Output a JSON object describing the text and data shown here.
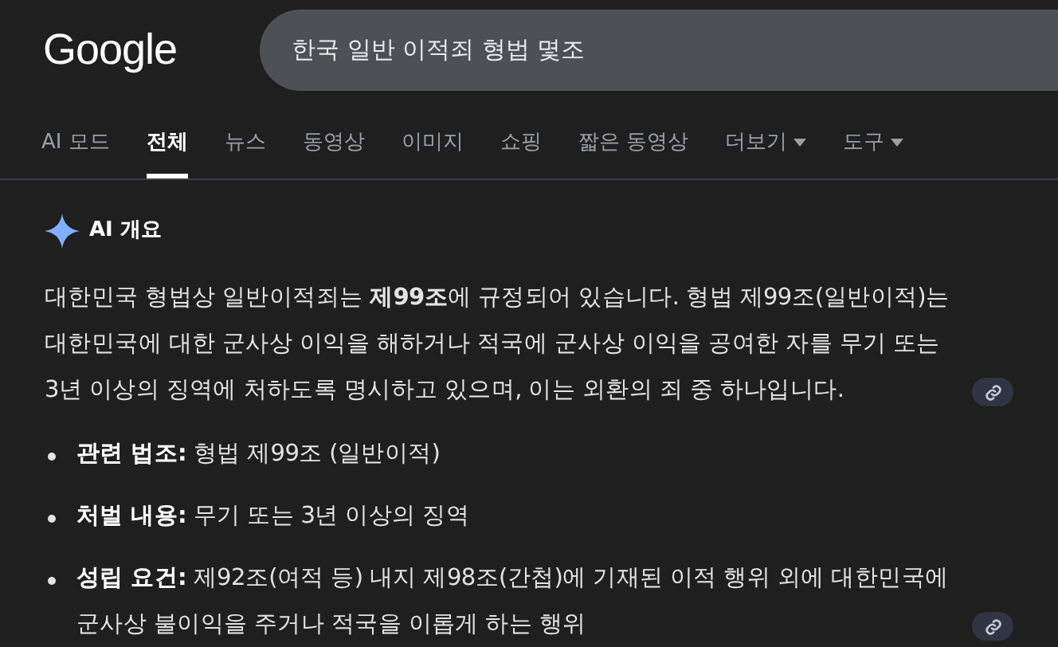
{
  "logo": "Google",
  "search": {
    "value": "한국 일반 이적죄 형법 몇조"
  },
  "tabs": [
    {
      "label": "AI 모드",
      "selected": false,
      "kind": "plain"
    },
    {
      "label": "전체",
      "selected": true,
      "kind": "plain"
    },
    {
      "label": "뉴스",
      "selected": false,
      "kind": "plain"
    },
    {
      "label": "동영상",
      "selected": false,
      "kind": "plain"
    },
    {
      "label": "이미지",
      "selected": false,
      "kind": "plain"
    },
    {
      "label": "쇼핑",
      "selected": false,
      "kind": "plain"
    },
    {
      "label": "짧은 동영상",
      "selected": false,
      "kind": "plain"
    },
    {
      "label": "더보기",
      "selected": false,
      "kind": "dropdown"
    },
    {
      "label": "도구",
      "selected": false,
      "kind": "dropdown"
    }
  ],
  "overview": {
    "title": "AI 개요",
    "paragraph": "대한민국 형법상 일반이적죄는 **제99조**에 규정되어 있습니다. 형법 제99조(일반이적)는 대한민국에 대한 군사상 이익을 해하거나 적국에 군사상 이익을 공여한 자를 무기 또는 3년 이상의 징역에 처하도록 명시하고 있으며, 이는 외환의 죄 중 하나입니다.",
    "paragraph_link": true,
    "bullets": [
      {
        "label": "관련 법조:",
        "text": "형법 제99조 (일반이적)",
        "link": false
      },
      {
        "label": "처벌 내용:",
        "text": "무기 또는 3년 이상의 징역",
        "link": false
      },
      {
        "label": "성립 요건:",
        "text": "제92조(여적 등) 내지 제98조(간첩)에 기재된 이적 행위 외에 대한민국에 군사상 불이익을 주거나 적국을 이롭게 하는 행위",
        "link": true
      }
    ]
  }
}
